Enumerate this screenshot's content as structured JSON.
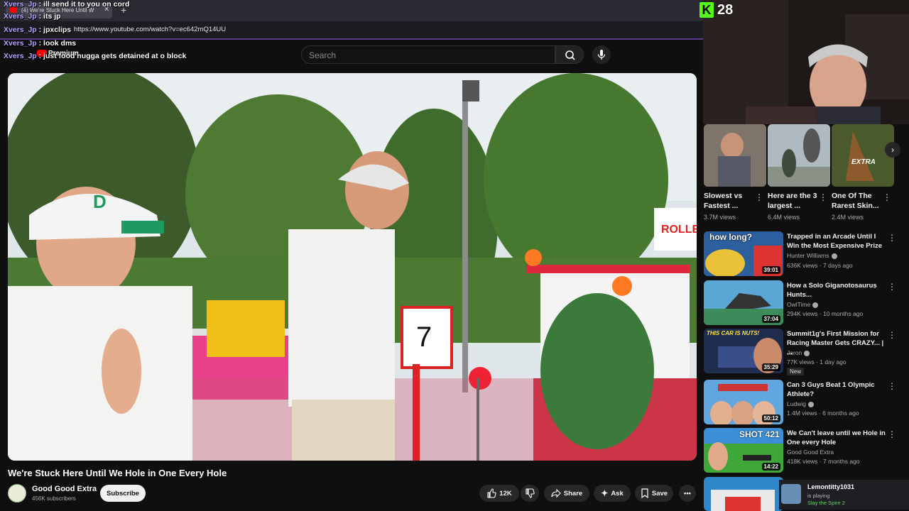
{
  "browser": {
    "tab_title": "(4) We're Stuck Here Until W",
    "url": "https://www.youtube.com/watch?v=ec642mQ14UU"
  },
  "youtube": {
    "search_placeholder": "Search",
    "premium_label": "Premium",
    "video_title": "We're Stuck Here Until We Hole in One Every Hole",
    "sign_text": "7",
    "banner_text": "ROLLE COASTE",
    "channel_name": "Good Good Extra",
    "subscribers": "456K subscribers",
    "subscribe_label": "Subscribe",
    "likes": "12K",
    "share_label": "Share",
    "ask_label": "Ask",
    "save_label": "Save"
  },
  "chat": [
    {
      "user": "Xvers_Jp",
      "message": "ill send it to you on cord"
    },
    {
      "user": "Xvers_Jp",
      "message": "its jp"
    },
    {
      "user": "Xvers_Jp",
      "message": "jpxclips"
    },
    {
      "user": "Xvers_Jp",
      "message": "look dms"
    },
    {
      "user": "Xvers_Jp",
      "message": "just food nugga gets detained at o block"
    }
  ],
  "stream": {
    "viewer_count": "28",
    "platform_logo": "K"
  },
  "shorts": [
    {
      "title": "Slowest vs Fastest ...",
      "views": "3.7M views"
    },
    {
      "title": "Here are the 3 largest ...",
      "views": "6.4M views"
    },
    {
      "title": "One Of The Rarest Skin...",
      "views": "2.4M views",
      "overlay": "EXTRA"
    }
  ],
  "recommended": [
    {
      "title": "Trapped in an Arcade Until I Win the Most Expensive Prize",
      "channel": "Hunter Williams",
      "meta": "636K views · 7 days ago",
      "duration": "39:01",
      "thumb_text": "how long?"
    },
    {
      "title": "How a Solo Giganotosaurus Hunts...",
      "channel": "OwlTime",
      "meta": "294K views · 10 months ago",
      "duration": "37:04",
      "thumb_text": ""
    },
    {
      "title": "Summit1g's First Mission for Racing Master Gets CRAZY... | ...",
      "channel": "Jaron",
      "meta": "77K views · 1 day ago",
      "duration": "35:29",
      "thumb_text": "THIS CAR IS NUTS!",
      "badge": "New"
    },
    {
      "title": "Can 3 Guys Beat 1 Olympic Athlete?",
      "channel": "Ludwig",
      "meta": "1.4M views · 6 months ago",
      "duration": "50:12",
      "thumb_text": ""
    },
    {
      "title": "We Can't leave until we Hole in One every Hole",
      "channel": "Good Good Extra",
      "meta": "418K views · 7 months ago",
      "duration": "14:22",
      "thumb_text": "SHOT 421"
    }
  ],
  "discord": {
    "name": "Lemontitty1031",
    "status": "is playing",
    "game": "Slay the Spire 2"
  }
}
